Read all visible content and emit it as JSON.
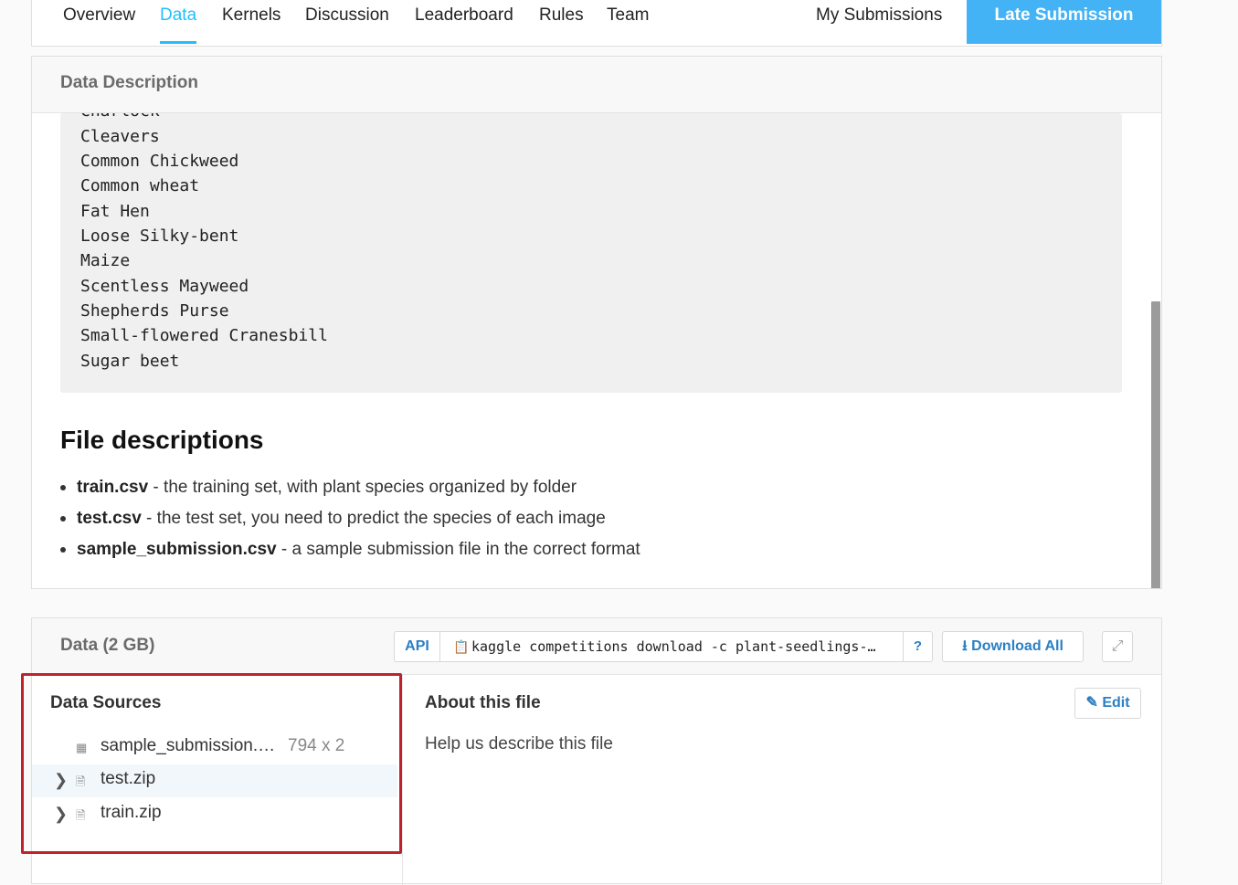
{
  "nav": {
    "tabs": [
      "Overview",
      "Data",
      "Kernels",
      "Discussion",
      "Leaderboard",
      "Rules",
      "Team"
    ],
    "active_tab": "Data",
    "my_submissions": "My Submissions",
    "late_submission": "Late Submission"
  },
  "description": {
    "title": "Data Description",
    "species_partial": "Charlock",
    "species": [
      "Cleavers",
      "Common Chickweed",
      "Common wheat",
      "Fat Hen",
      "Loose Silky-bent",
      "Maize",
      "Scentless Mayweed",
      "Shepherds Purse",
      "Small-flowered Cranesbill",
      "Sugar beet"
    ],
    "file_descriptions_title": "File descriptions",
    "files": [
      {
        "name": "train.csv",
        "text": " - the training set, with plant species organized by folder"
      },
      {
        "name": "test.csv",
        "text": " - the test set, you need to predict the species of each image"
      },
      {
        "name": "sample_submission.csv",
        "text": " - a sample submission file in the correct format"
      }
    ]
  },
  "data_panel": {
    "title": "Data (2 GB)",
    "api_label": "API",
    "api_command": "kaggle competitions download -c plant-seedlings-…",
    "help_label": "?",
    "download_all": "Download All",
    "sources_title": "Data Sources",
    "sources": [
      {
        "name": "sample_submission.…",
        "meta": "794 x 2",
        "icon": "table-icon",
        "expandable": false
      },
      {
        "name": "test.zip",
        "meta": "",
        "icon": "zip-file-icon",
        "expandable": true
      },
      {
        "name": "train.zip",
        "meta": "",
        "icon": "zip-file-icon",
        "expandable": true
      }
    ],
    "about_title": "About this file",
    "about_text": "Help us describe this file",
    "edit_label": "Edit"
  },
  "colors": {
    "accent": "#20beff",
    "late_button": "#44b3f5",
    "link": "#2b7fc4",
    "highlight_box": "#c0222d"
  }
}
